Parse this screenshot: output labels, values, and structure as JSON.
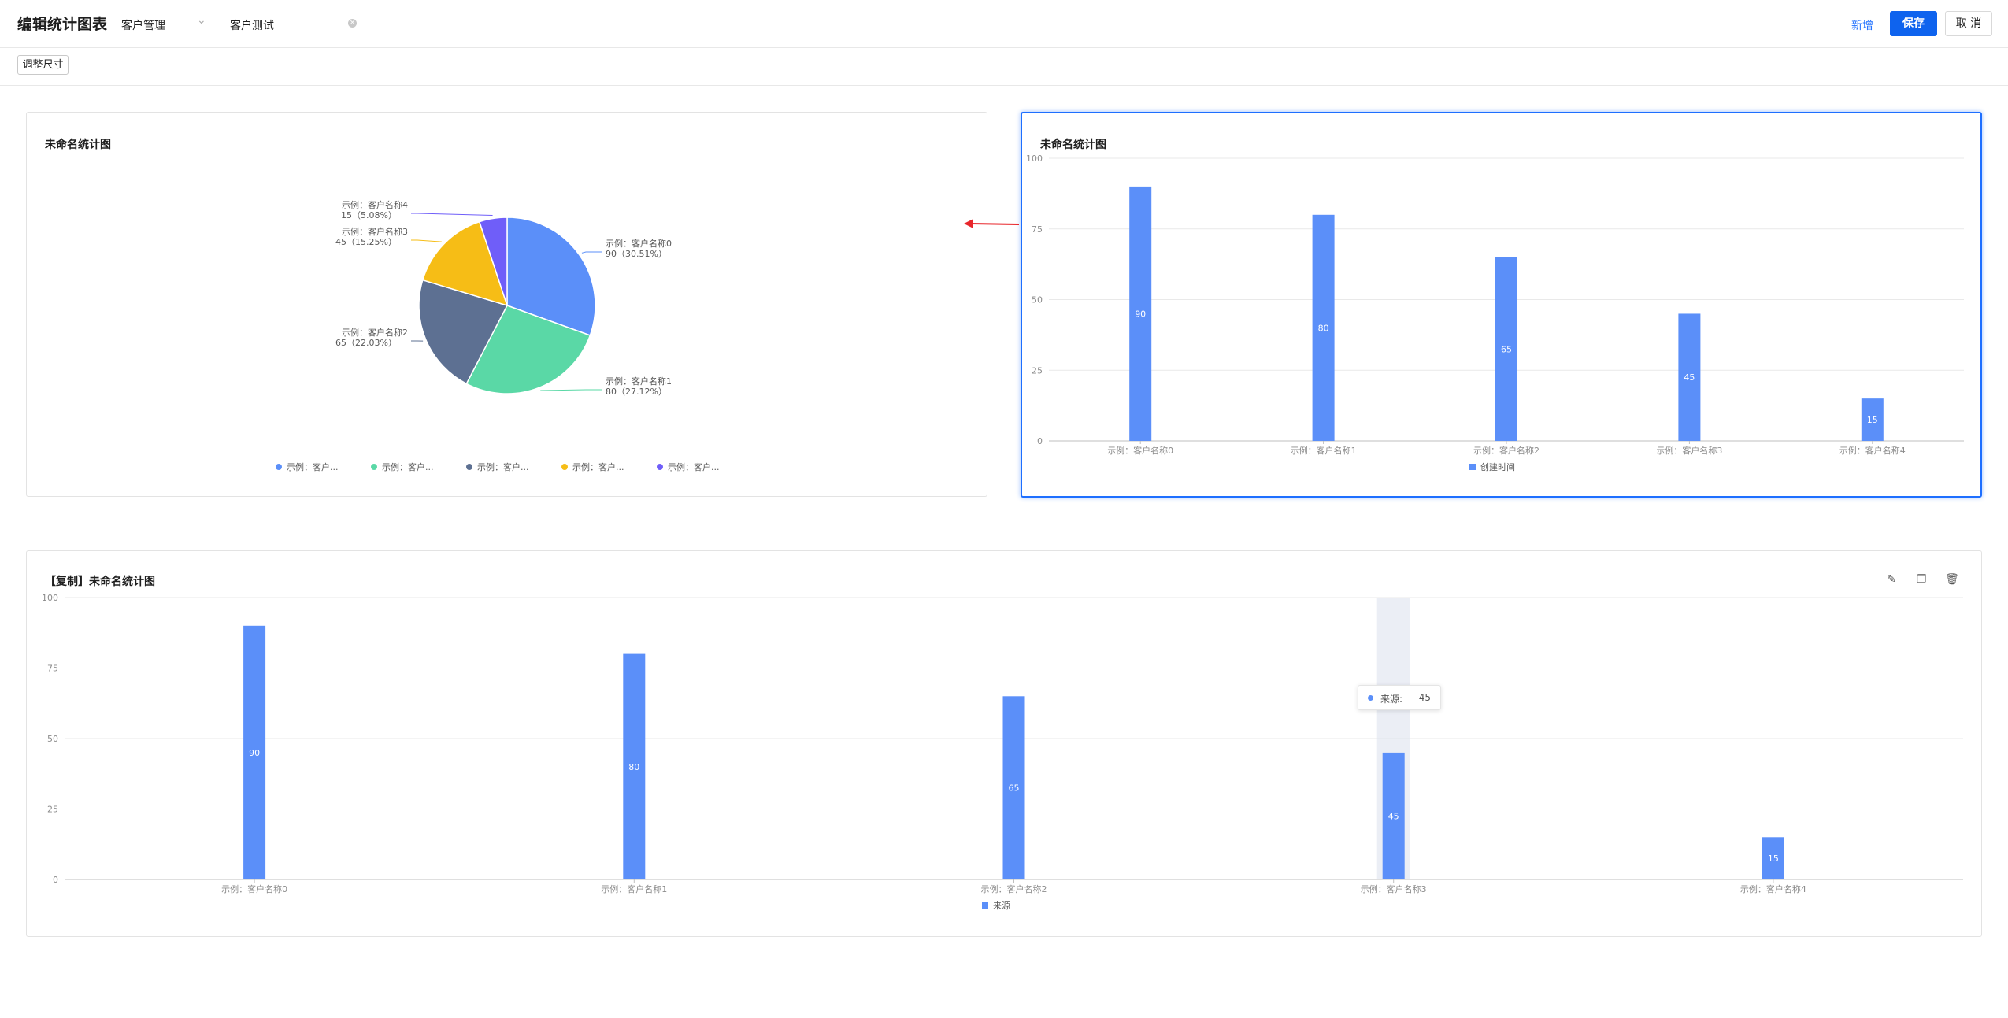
{
  "header": {
    "title": "编辑统计图表",
    "module_value": "客户管理",
    "name_value": "客户测试",
    "add_label": "新增",
    "save_label": "保存",
    "cancel_label": "取 消"
  },
  "toolbar": {
    "resize_label": "调整尺寸"
  },
  "colors": {
    "primary": "#1e6fff",
    "bar": "#5b8ff9",
    "pie": [
      "#5b8ff9",
      "#5ad8a6",
      "#5d7092",
      "#f6bd16",
      "#6f5ef9"
    ]
  },
  "chart_data": [
    {
      "type": "pie",
      "title": "未命名统计图",
      "categories": [
        "示例：客户名称0",
        "示例：客户名称1",
        "示例：客户名称2",
        "示例：客户名称3",
        "示例：客户名称4"
      ],
      "values": [
        90,
        80,
        65,
        45,
        15
      ],
      "percent_labels": [
        "90（30.51%）",
        "80（27.12%）",
        "65（22.03%）",
        "45（15.25%）",
        "15（5.08%）"
      ],
      "legend": [
        "示例：客户...",
        "示例：客户...",
        "示例：客户...",
        "示例：客户...",
        "示例：客户..."
      ],
      "legend_position": "bottom"
    },
    {
      "type": "bar",
      "title": "未命名统计图",
      "categories": [
        "示例：客户名称0",
        "示例：客户名称1",
        "示例：客户名称2",
        "示例：客户名称3",
        "示例：客户名称4"
      ],
      "series": [
        {
          "name": "创建时间",
          "values": [
            90,
            80,
            65,
            45,
            15
          ]
        }
      ],
      "ylim": [
        0,
        100
      ],
      "yticks": [
        "0",
        "25",
        "50",
        "75",
        "100"
      ],
      "grid": true,
      "legend_position": "bottom",
      "selected": true
    },
    {
      "type": "bar",
      "title": "【复制】未命名统计图",
      "categories": [
        "示例：客户名称0",
        "示例：客户名称1",
        "示例：客户名称2",
        "示例：客户名称3",
        "示例：客户名称4"
      ],
      "series": [
        {
          "name": "来源",
          "values": [
            90,
            80,
            65,
            45,
            15
          ]
        }
      ],
      "ylim": [
        0,
        100
      ],
      "yticks": [
        "0",
        "25",
        "50",
        "75",
        "100"
      ],
      "grid": true,
      "legend_position": "bottom",
      "tooltip": {
        "label": "来源:",
        "value": "45"
      },
      "hover_index": 3,
      "actions": [
        "edit-icon",
        "copy-icon",
        "delete-icon"
      ]
    }
  ]
}
